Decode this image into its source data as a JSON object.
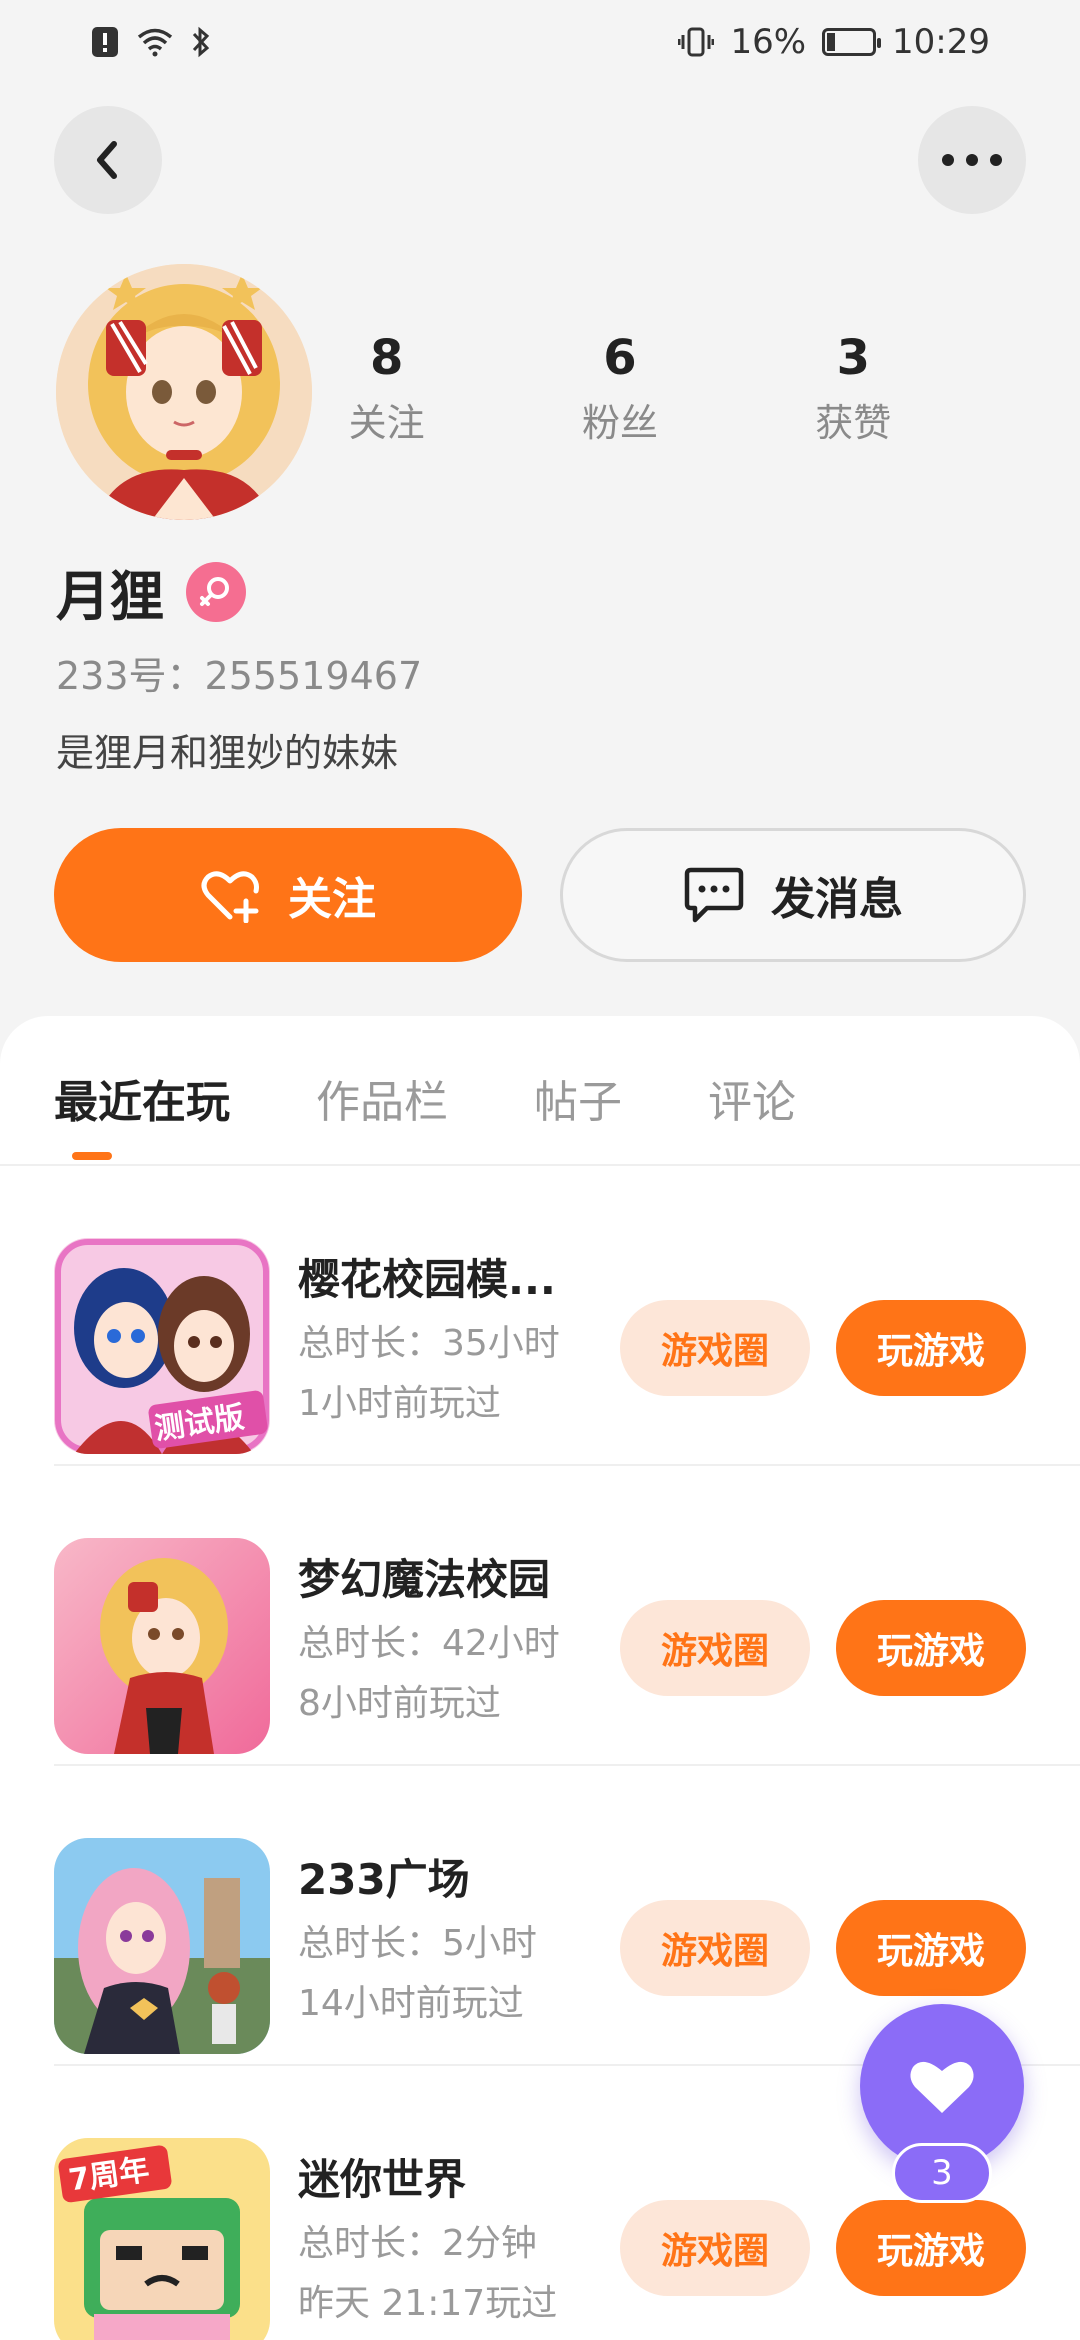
{
  "status_bar": {
    "battery_percent": "16%",
    "time": "10:29",
    "icons": [
      "alert-icon",
      "wifi-icon",
      "bluetooth-icon",
      "vibrate-icon",
      "battery-charging-icon"
    ]
  },
  "nav": {
    "back_icon": "back-arrow-icon",
    "more_icon": "more-dots-icon"
  },
  "profile": {
    "name": "月狸",
    "gender_icon": "female-icon",
    "uid": "233号：255519467",
    "bio": "是狸月和狸妙的妹妹",
    "stats": [
      {
        "value": "8",
        "label": "关注"
      },
      {
        "value": "6",
        "label": "粉丝"
      },
      {
        "value": "3",
        "label": "获赞"
      }
    ]
  },
  "actions": {
    "follow_label": "关注",
    "message_label": "发消息"
  },
  "tabs": [
    {
      "label": "最近在玩",
      "active": true
    },
    {
      "label": "作品栏",
      "active": false
    },
    {
      "label": "帖子",
      "active": false
    },
    {
      "label": "评论",
      "active": false
    }
  ],
  "games": [
    {
      "name": "樱花校园模...",
      "duration": "总时长：35小时",
      "last_played": "1小时前玩过",
      "circle_label": "游戏圈",
      "play_label": "玩游戏",
      "icon_badge": "测试版"
    },
    {
      "name": "梦幻魔法校园",
      "duration": "总时长：42小时",
      "last_played": "8小时前玩过",
      "circle_label": "游戏圈",
      "play_label": "玩游戏"
    },
    {
      "name": "233广场",
      "duration": "总时长：5小时",
      "last_played": "14小时前玩过",
      "circle_label": "游戏圈",
      "play_label": "玩游戏"
    },
    {
      "name": "迷你世界",
      "duration": "总时长：2分钟",
      "last_played": "昨天 21:17玩过",
      "circle_label": "游戏圈",
      "play_label": "玩游戏",
      "icon_badge": "7周年"
    }
  ],
  "floating_like": {
    "count": "3",
    "icon": "heart-icon"
  },
  "colors": {
    "accent": "#ff7417",
    "accent_light": "#fde6d8",
    "fab": "#8b6cf7",
    "female": "#f56e91"
  }
}
